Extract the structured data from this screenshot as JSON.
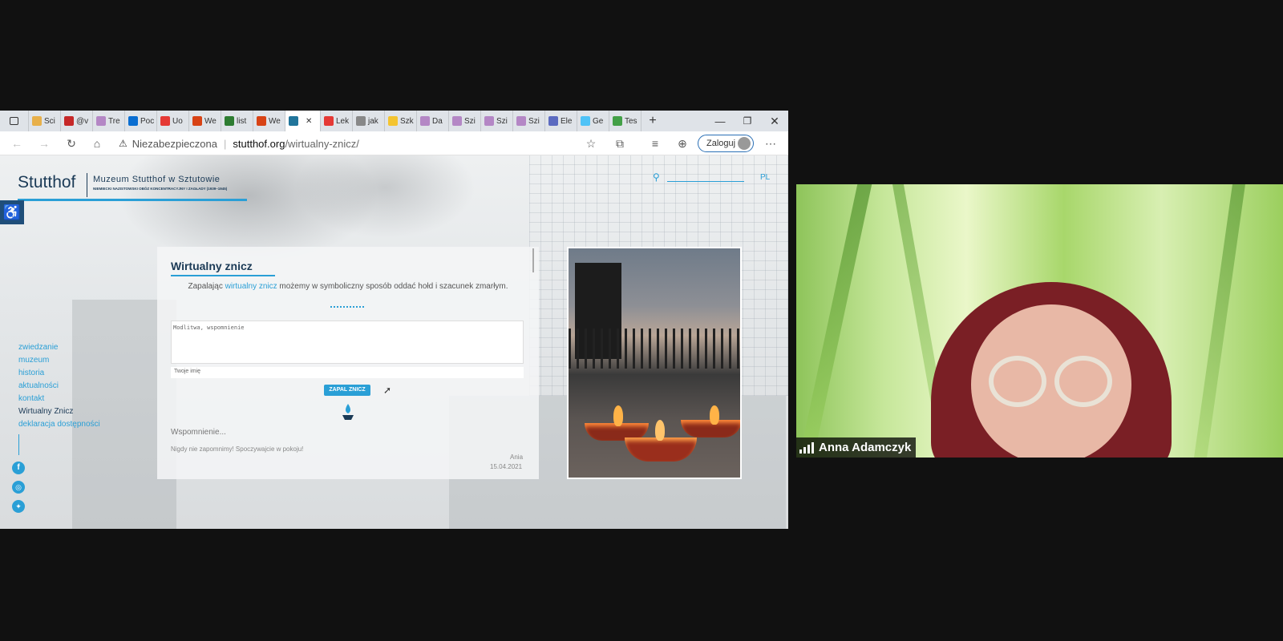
{
  "browser": {
    "tabs": [
      {
        "label": "Sci",
        "color": "#e8b04a"
      },
      {
        "label": "@v",
        "color": "#c62828"
      },
      {
        "label": "Tre",
        "color": "#b487c5"
      },
      {
        "label": "Poc",
        "color": "#0a6ed1"
      },
      {
        "label": "Uo",
        "color": "#e53935"
      },
      {
        "label": "We",
        "color": "#d84315"
      },
      {
        "label": "list",
        "color": "#2e7d32"
      },
      {
        "label": "We",
        "color": "#d84315"
      },
      {
        "label": "",
        "color": "#21759b",
        "active": true
      },
      {
        "label": "Lek",
        "color": "#e53935"
      },
      {
        "label": "jak",
        "color": "#888888"
      },
      {
        "label": "Szk",
        "color": "#f4c430"
      },
      {
        "label": "Da",
        "color": "#b487c5"
      },
      {
        "label": "Szi",
        "color": "#b487c5"
      },
      {
        "label": "Szi",
        "color": "#b487c5"
      },
      {
        "label": "Szi",
        "color": "#b487c5"
      },
      {
        "label": "Ele",
        "color": "#5c6bc0"
      },
      {
        "label": "Ge",
        "color": "#4fc3f7"
      },
      {
        "label": "Tes",
        "color": "#43a047"
      }
    ],
    "insecure_label": "Niezabezpieczona",
    "url_domain": "stutthof.org",
    "url_path": "/wirtualny-znicz/",
    "login_label": "Zaloguj"
  },
  "site": {
    "logo": "Stutthof",
    "museum_name": "Muzeum Stutthof w Sztutowie",
    "museum_sub": "NIEMIECKI NAZISTOWSKI OBÓZ KONCENTRACYJNY I ZAGŁADY (1939–1945)",
    "lang": "PL",
    "menu": [
      "zwiedzanie",
      "muzeum",
      "historia",
      "aktualności",
      "kontakt",
      "Wirtualny Znicz",
      "deklaracja dostępności"
    ],
    "heading": "Wirtualny znicz",
    "intro_before": "Zapalając ",
    "intro_link": "wirtualny znicz",
    "intro_after": " możemy w symboliczny sposób oddać hołd i szacunek zmarłym.",
    "textarea_placeholder": "Modlitwa, wspomnienie",
    "name_placeholder": "Twoje imię",
    "submit_label": "ZAPAL ZNICZ",
    "memory_title": "Wspomnienie...",
    "memory_text": "Nigdy nie zapomnimy! Spoczywajcie w pokoju!",
    "memory_author": "Ania",
    "memory_date": "15.04.2021",
    "accent": "#2a9fd6"
  },
  "video": {
    "participant": "Anna Adamczyk"
  }
}
